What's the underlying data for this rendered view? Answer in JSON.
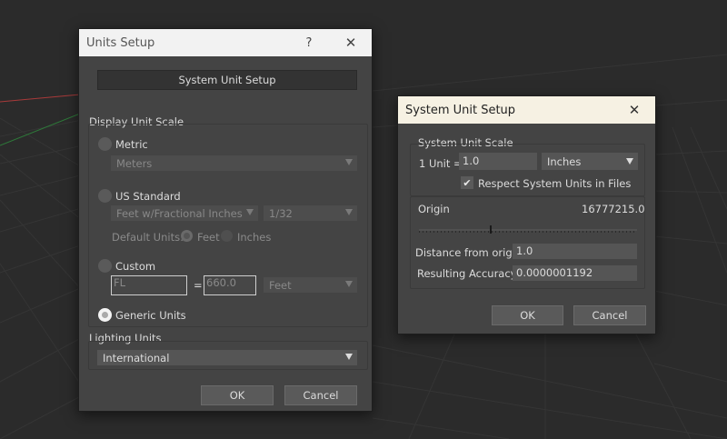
{
  "units_setup": {
    "title": "Units Setup",
    "help_glyph": "?",
    "close_glyph": "✕",
    "system_unit_setup_button": "System Unit Setup",
    "display_unit_scale_label": "Display Unit Scale",
    "metric": {
      "label": "Metric",
      "selected": false,
      "dropdown_value": "Meters"
    },
    "us_standard": {
      "label": "US Standard",
      "selected": false,
      "format_value": "Feet w/Fractional Inches",
      "fraction_value": "1/32",
      "default_units_label": "Default Units:",
      "feet_label": "Feet",
      "inches_label": "Inches"
    },
    "custom": {
      "label": "Custom",
      "selected": false,
      "name_value": "FL",
      "equals": "=",
      "amount_value": "660.0",
      "unit_value": "Feet"
    },
    "generic_units": {
      "label": "Generic Units",
      "selected": true
    },
    "lighting_units_label": "Lighting Units",
    "lighting_units_value": "International",
    "ok_label": "OK",
    "cancel_label": "Cancel"
  },
  "system_unit_setup": {
    "title": "System Unit Setup",
    "close_glyph": "✕",
    "scale_label": "System Unit Scale",
    "unit_eq_label": "1 Unit =",
    "unit_value": "1.0",
    "unit_type": "Inches",
    "respect_label": "Respect System Units in Files",
    "respect_checked": true,
    "check_glyph": "✔",
    "origin_label": "Origin",
    "origin_value": "16777215.0",
    "distance_label": "Distance from origin:",
    "distance_value": "1.0",
    "accuracy_label": "Resulting Accuracy:",
    "accuracy_value": "0.0000001192",
    "ok_label": "OK",
    "cancel_label": "Cancel"
  },
  "colors": {
    "viewport_bg": "#2b2b2b",
    "dialog_bg": "#444444",
    "titlebar_light": "#f2f2f2",
    "titlebar_cream": "#f6f1e3",
    "grid_red": "#a83a3a",
    "grid_green": "#2e7a3a"
  }
}
